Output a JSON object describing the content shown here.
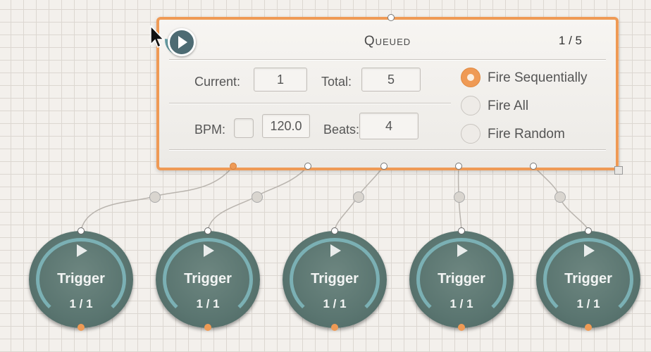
{
  "queued_node": {
    "title": "Queued",
    "counter": "1 / 5",
    "current_label": "Current:",
    "current_value": "1",
    "total_label": "Total:",
    "total_value": "5",
    "bpm_label": "BPM:",
    "bpm_checked": false,
    "bpm_value": "120.0",
    "beats_label": "Beats:",
    "beats_value": "4",
    "fire_options": [
      {
        "label": "Fire Sequentially",
        "selected": true
      },
      {
        "label": "Fire All",
        "selected": false
      },
      {
        "label": "Fire Random",
        "selected": false
      }
    ],
    "accent_color": "#ef9a55"
  },
  "triggers": [
    {
      "label": "Trigger",
      "count": "1 / 1"
    },
    {
      "label": "Trigger",
      "count": "1 / 1"
    },
    {
      "label": "Trigger",
      "count": "1 / 1"
    },
    {
      "label": "Trigger",
      "count": "1 / 1"
    },
    {
      "label": "Trigger",
      "count": "1 / 1"
    }
  ],
  "icons": {
    "play": "play-icon",
    "cursor": "mouse-cursor-icon",
    "resize": "resize-handle-icon"
  },
  "colors": {
    "trigger_body": "#5a7570",
    "trigger_ring": "#7bb0b4",
    "background": "#f3f0ec"
  }
}
